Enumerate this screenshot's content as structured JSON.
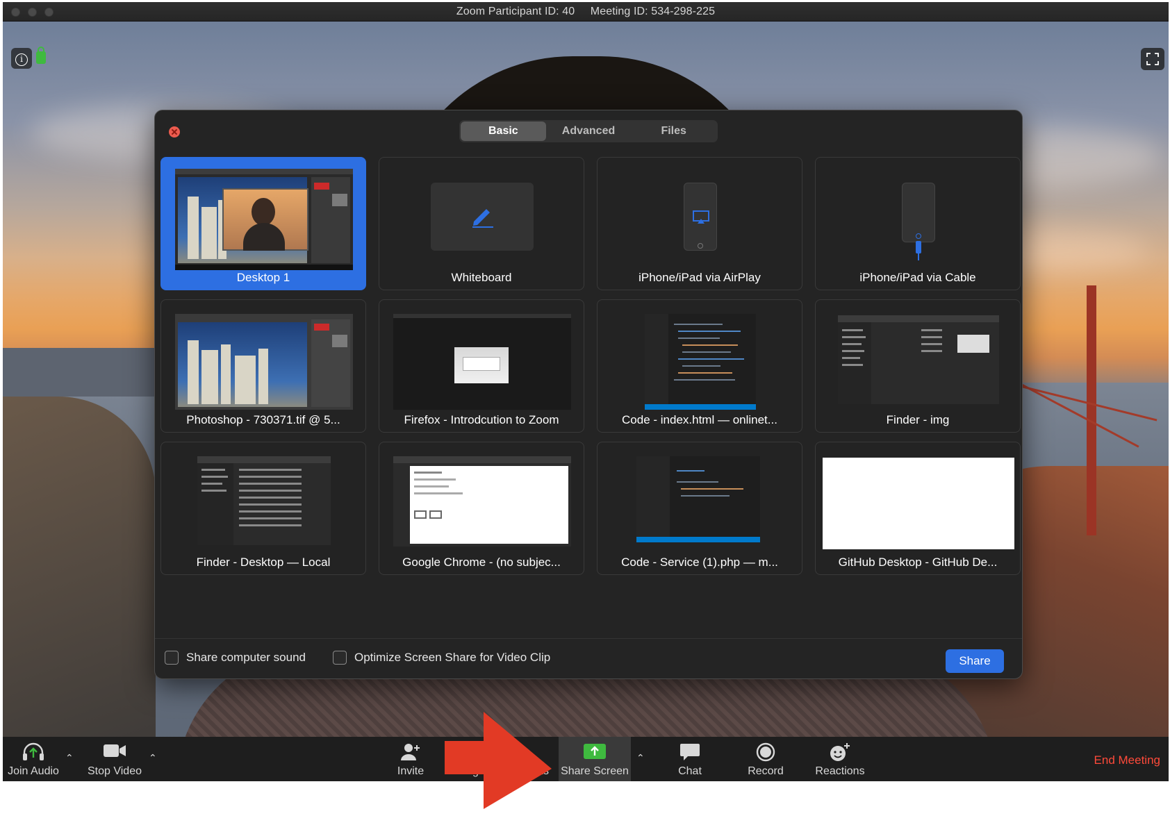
{
  "window": {
    "title_participant": "Zoom Participant ID: 40",
    "title_meeting": "Meeting ID: 534-298-225"
  },
  "video_overlay": {
    "info_icon": "info-icon",
    "lock_icon": "lock-icon",
    "fullscreen_icon": "fullscreen-icon"
  },
  "dialog": {
    "tabs": [
      {
        "label": "Basic",
        "active": true
      },
      {
        "label": "Advanced",
        "active": false
      },
      {
        "label": "Files",
        "active": false
      }
    ],
    "tiles": [
      {
        "label": "Desktop 1",
        "selected": true,
        "thumb": "desktop-screenshot"
      },
      {
        "label": "Whiteboard",
        "selected": false,
        "thumb": "pencil-icon"
      },
      {
        "label": "iPhone/iPad via AirPlay",
        "selected": false,
        "thumb": "airplay-phone-icon"
      },
      {
        "label": "iPhone/iPad via Cable",
        "selected": false,
        "thumb": "cable-phone-icon"
      },
      {
        "label": "Photoshop - 730371.tif @ 5...",
        "selected": false,
        "thumb": "photoshop-window"
      },
      {
        "label": "Firefox - Introdcution to Zoom",
        "selected": false,
        "thumb": "firefox-window"
      },
      {
        "label": "Code - index.html — onlinet...",
        "selected": false,
        "thumb": "code-window"
      },
      {
        "label": "Finder - img",
        "selected": false,
        "thumb": "finder-window"
      },
      {
        "label": "Finder - Desktop — Local",
        "selected": false,
        "thumb": "finder-window"
      },
      {
        "label": "Google Chrome - (no subjec...",
        "selected": false,
        "thumb": "chrome-window"
      },
      {
        "label": "Code - Service (1).php — m...",
        "selected": false,
        "thumb": "code-window"
      },
      {
        "label": "GitHub Desktop - GitHub De...",
        "selected": false,
        "thumb": "blank-window"
      }
    ],
    "share_sound_label": "Share computer sound",
    "optimize_label": "Optimize Screen Share for Video Clip",
    "share_button": "Share"
  },
  "toolbar": {
    "join_audio": "Join Audio",
    "stop_video": "Stop Video",
    "invite": "Invite",
    "manage_participants_partial_left": "Manag",
    "manage_participants_partial_right": "ants",
    "share_screen": "Share Screen",
    "chat": "Chat",
    "record": "Record",
    "reactions": "Reactions",
    "end_meeting": "End Meeting"
  },
  "colors": {
    "accent_blue": "#2d6fe2",
    "end_meeting_red": "#ff4a3a",
    "share_green": "#3fba3f",
    "annotation_arrow": "#e23a25"
  }
}
